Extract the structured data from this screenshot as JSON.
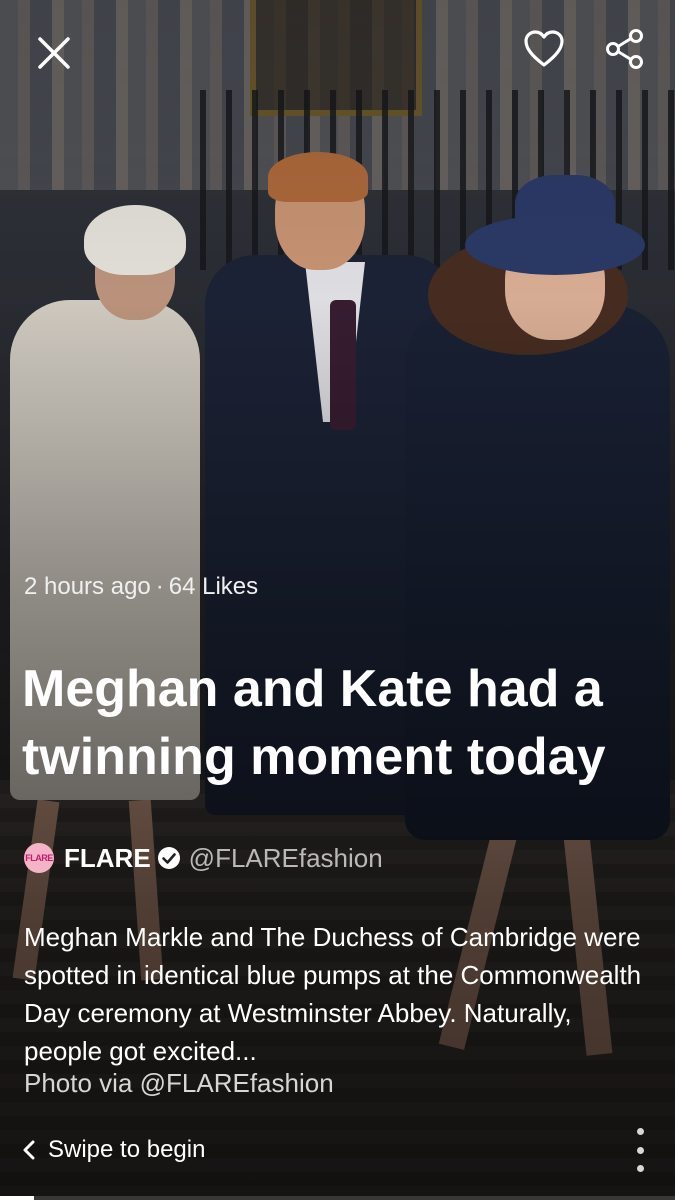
{
  "story": {
    "time": "2 hours ago",
    "likes": "64 Likes",
    "title": "Meghan and Kate had a twinning moment today",
    "source": {
      "logo_text": "FLARE",
      "name": "FLARE",
      "handle": "@FLAREfashion",
      "verified": true
    },
    "body": "Meghan Markle and The Duchess of Cambridge were spotted in identical blue pumps at the Commonwealth Day ceremony at Westminster Abbey.  Naturally, people got excited...",
    "credit": "Photo via @FLAREfashion",
    "swipe_label": "Swipe to begin"
  },
  "icons": {
    "close": "close-icon",
    "like": "heart-icon",
    "share": "share-icon",
    "back": "chevron-left-icon",
    "more": "more-vertical-icon",
    "verified": "verified-badge-icon"
  },
  "colors": {
    "text": "#ffffff",
    "handle": "#b9b9b9",
    "logo_bg": "#f5b3c8",
    "logo_text": "#c21e6b"
  }
}
